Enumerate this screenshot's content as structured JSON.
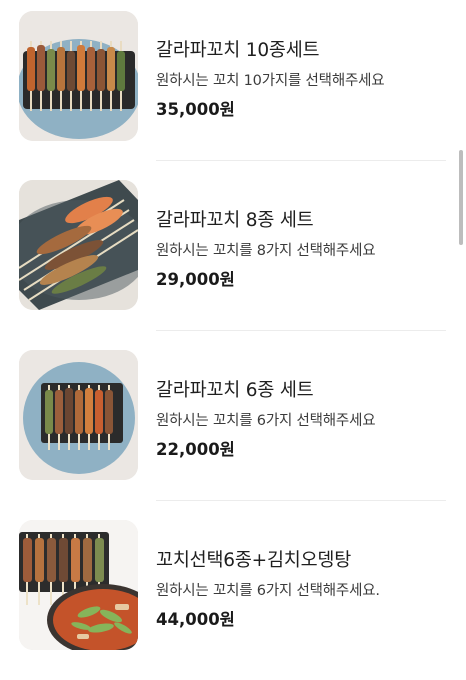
{
  "menu": {
    "items": [
      {
        "title": "갈라파꼬치 10종세트",
        "description": "원하시는 꼬치 10가지를 선택해주세요",
        "price": "35,000원",
        "image": "skewer-platter-10"
      },
      {
        "title": "갈라파꼬치 8종 세트",
        "description": "원하시는 꼬치를 8가지 선택해주세요",
        "price": "29,000원",
        "image": "skewer-platter-8-shrimp"
      },
      {
        "title": "갈라파꼬치 6종 세트",
        "description": "원하시는 꼬치를 6가지 선택해주세요",
        "price": "22,000원",
        "image": "skewer-platter-6"
      },
      {
        "title": "꼬치선택6종+김치오뎅탕",
        "description": "원하시는 꼬치를 6가지 선택해주세요.",
        "price": "44,000원",
        "image": "skewers-and-kimchi-odeng-soup"
      }
    ]
  },
  "colors": {
    "plate_blue": "#8fb1c4",
    "background": "#ffffff",
    "divider": "#ececec"
  }
}
